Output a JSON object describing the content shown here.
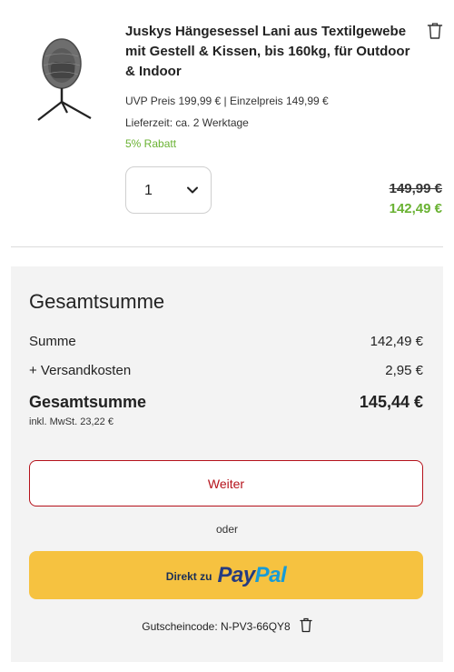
{
  "product": {
    "title": "Juskys Hängesessel Lani aus Textilgewebe mit Gestell & Kissen, bis 160kg, für Outdoor & Indoor",
    "image_icon": "hanging-chair-image",
    "uvp": "UVP Preis  199,99 € | Einzelpreis  149,99 €",
    "delivery": "Lieferzeit:  ca. 2 Werktage",
    "discount": "5% Rabatt",
    "quantity": "1",
    "old_price": "149,99 €",
    "new_price": "142,49 €",
    "delete_icon": "trash-icon"
  },
  "summary": {
    "title": "Gesamtsumme",
    "rows": [
      {
        "label": "Summe",
        "value": "142,49 €"
      },
      {
        "label": "+ Versandkosten",
        "value": "2,95 €"
      }
    ],
    "total_label": "Gesamtsumme",
    "total_value": "145,44 €",
    "tax_note": "inkl. MwSt. 23,22 €",
    "continue_label": "Weiter",
    "or_label": "oder",
    "paypal_prefix": "Direkt zu",
    "paypal_logo_pay": "Pay",
    "paypal_logo_pal": "Pal",
    "coupon_text": "Gutscheincode: N-PV3-66QY8"
  },
  "colors": {
    "accent_red": "#b5121b",
    "discount_green": "#6ab233",
    "paypal_yellow": "#f6c240",
    "summary_bg": "#f3f3f3"
  }
}
